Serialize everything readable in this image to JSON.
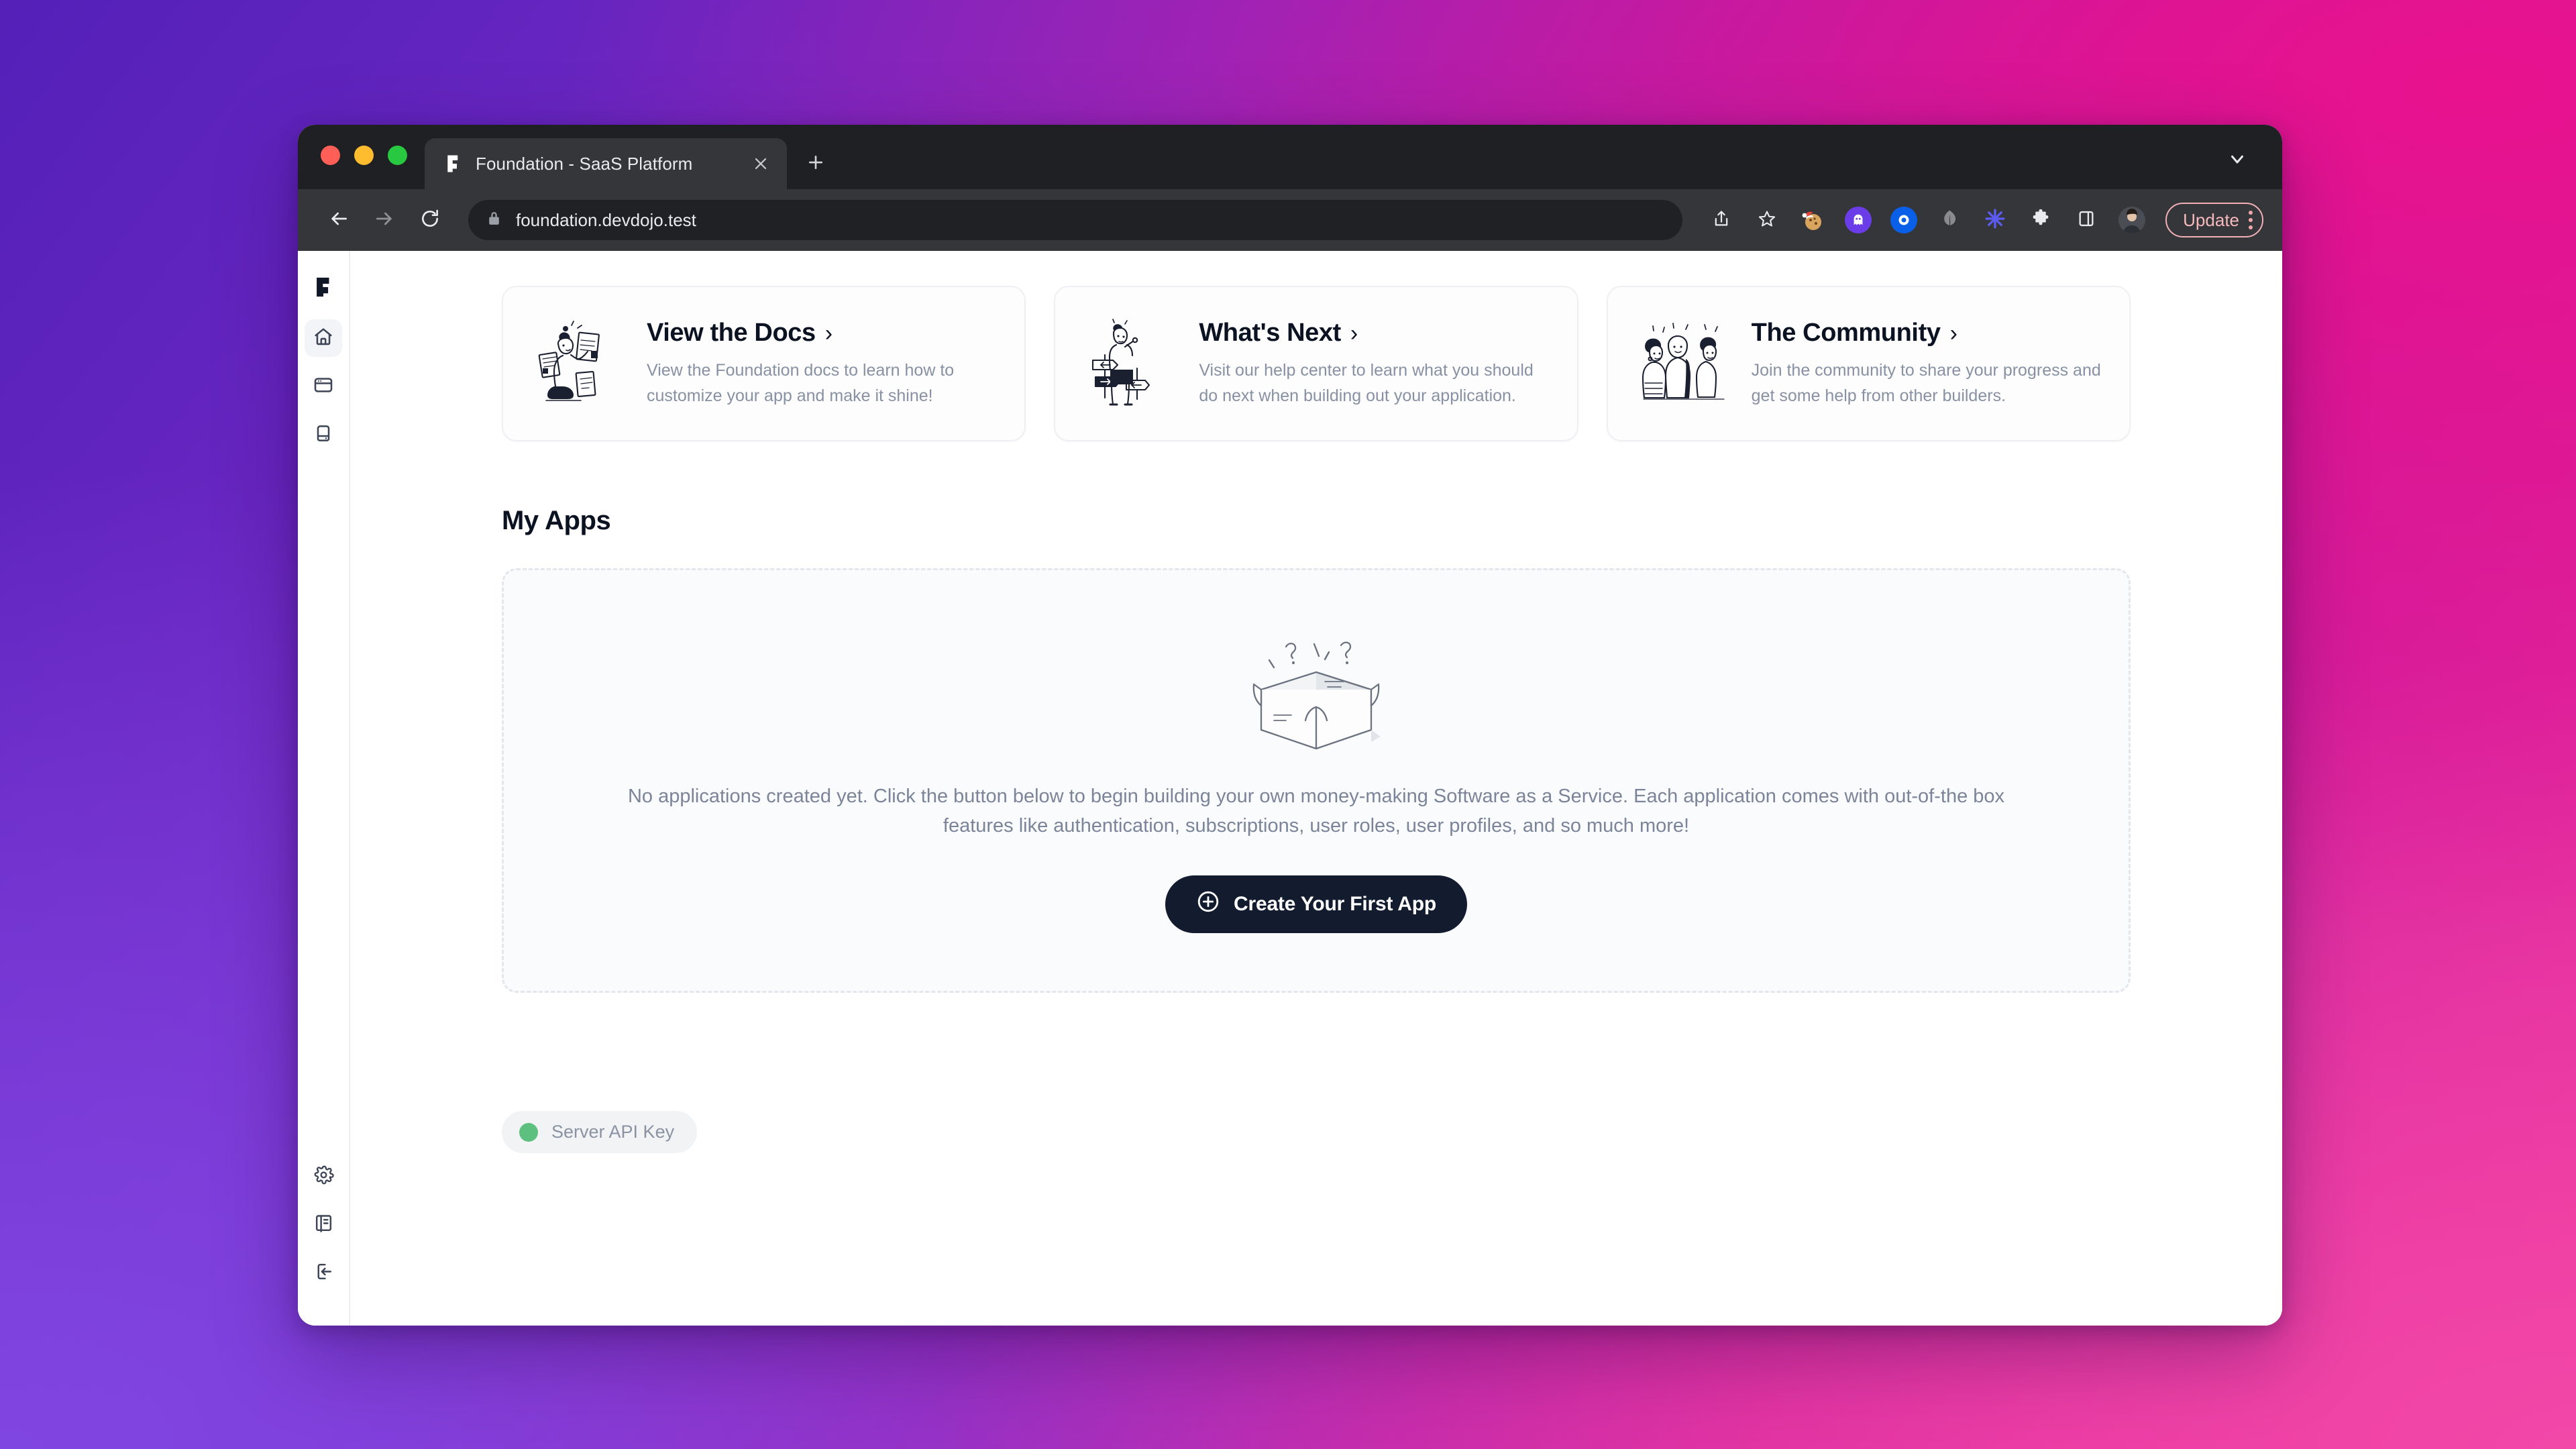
{
  "browser": {
    "tab": {
      "title": "Foundation - SaaS Platform",
      "favicon_icon": "foundation-flag-icon",
      "close_icon": "close-icon",
      "new_tab_icon": "plus-icon",
      "tab_search_icon": "chevron-down-icon"
    },
    "toolbar": {
      "back_icon": "arrow-left-icon",
      "forward_icon": "arrow-right-icon",
      "reload_icon": "reload-icon",
      "lock_icon": "lock-icon",
      "url": "foundation.devdojo.test",
      "share_icon": "share-icon",
      "bookmark_icon": "star-icon",
      "extensions": [
        {
          "name": "cookie-extension-icon",
          "color": "#d8a05a"
        },
        {
          "name": "ghost-extension-icon",
          "color": "#6a3de8"
        },
        {
          "name": "blue-circle-extension-icon",
          "color": "#0a5fe8"
        },
        {
          "name": "gray-leaf-extension-icon",
          "color": "#8a8a8f"
        },
        {
          "name": "asterisk-extension-icon",
          "color": "#5b5bf0"
        }
      ],
      "puzzle_icon": "puzzle-piece-icon",
      "sidepanel_icon": "side-panel-icon",
      "avatar_icon": "user-avatar",
      "update_label": "Update",
      "menu_icon": "kebab-menu-icon"
    },
    "traffic_lights": {
      "close": "#ff5f57",
      "minimize": "#febc2e",
      "zoom": "#28c840"
    }
  },
  "sidebar": {
    "logo_icon": "foundation-logo-icon",
    "items": [
      {
        "name": "home",
        "icon": "home-icon",
        "active": true
      },
      {
        "name": "apps",
        "icon": "browser-window-icon",
        "active": false
      },
      {
        "name": "servers",
        "icon": "server-icon",
        "active": false
      }
    ],
    "bottom_items": [
      {
        "name": "settings",
        "icon": "gear-icon"
      },
      {
        "name": "docs",
        "icon": "book-icon"
      },
      {
        "name": "logout",
        "icon": "logout-icon"
      }
    ]
  },
  "cards": [
    {
      "title": "View the Docs",
      "chevron": "›",
      "description": "View the Foundation docs to learn how to customize your app and make it shine!",
      "illustration": "person-reading-documents-illustration"
    },
    {
      "title": "What's Next",
      "chevron": "›",
      "description": "Visit our help center to learn what you should do next when building out your application.",
      "illustration": "person-with-signposts-illustration"
    },
    {
      "title": "The Community",
      "chevron": "›",
      "description": "Join the community to share your progress and get some help from other builders.",
      "illustration": "group-of-people-illustration"
    }
  ],
  "main": {
    "section_title": "My Apps",
    "empty_state": {
      "illustration": "empty-open-box-illustration",
      "message": "No applications created yet. Click the button below to begin building your own money-making Software as a Service. Each application comes with out-of-the box features like authentication, subscriptions, user roles, user profiles, and so much more!",
      "button_label": "Create Your First App",
      "button_icon": "plus-circle-icon"
    },
    "api_key_badge": {
      "label": "Server API Key",
      "status_color": "#5ec07e"
    }
  },
  "theme": {
    "accent_dark": "#131c2e",
    "bg_gradient_top_left": "#5320b8",
    "bg_gradient_top_right": "#e8128e",
    "bg_gradient_bottom_left": "#8046e2",
    "bg_gradient_bottom_right": "#f248a8"
  }
}
